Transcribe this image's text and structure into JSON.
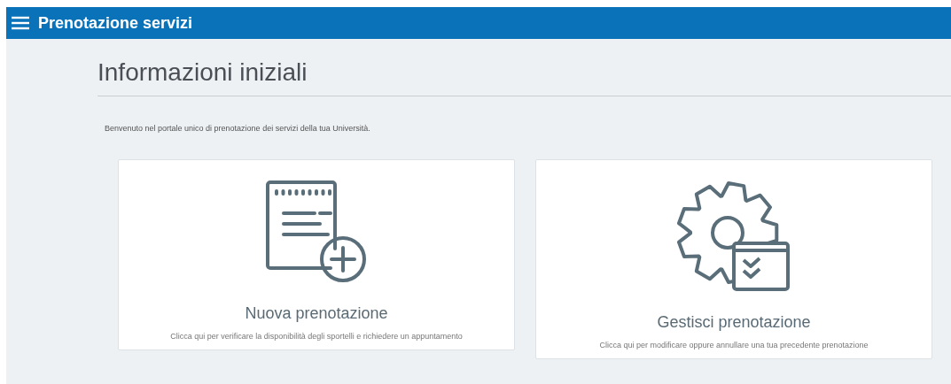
{
  "header": {
    "title": "Prenotazione servizi"
  },
  "page": {
    "heading": "Informazioni iniziali",
    "intro": "Benvenuto nel portale unico di prenotazione dei servizi della tua Università."
  },
  "cards": [
    {
      "kind": "new",
      "title": "Nuova prenotazione",
      "description": "Clicca qui per verificare la disponibilità degli sportelli e richiedere un appuntamento"
    },
    {
      "kind": "manage",
      "title": "Gestisci prenotazione",
      "description": "Clicca qui per modificare oppure annullare una tua precedente prenotazione"
    }
  ]
}
